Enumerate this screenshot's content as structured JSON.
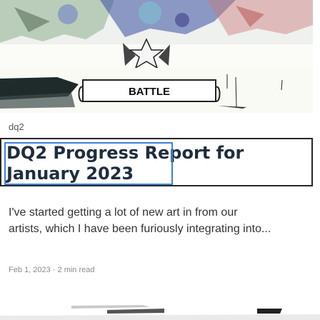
{
  "post": {
    "hero_image": {
      "alt_text": "BATTLE"
    },
    "blog_tag": "dq2",
    "title": "DQ2 Progress Report for January 2023",
    "excerpt_line_1": "I've started getting a lot of new art in from our",
    "excerpt_line_2": "artists, which I have been furiously integrating into...",
    "date": "Feb 1, 2023",
    "separator": "·",
    "read_time": "2 min read"
  },
  "colors": {
    "title": "#1f2d3d",
    "title_border": "#262626",
    "selection_border": "#3f80d6",
    "body_text": "#333333",
    "meta_text": "#8a8a8a"
  },
  "icons": [
    "star-icon",
    "banner-icon"
  ]
}
